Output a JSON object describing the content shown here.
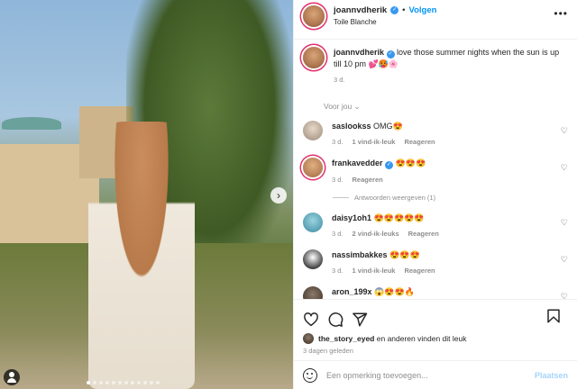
{
  "post": {
    "username": "joannvdherik",
    "follow_label": "Volgen",
    "separator": "•",
    "location": "Toile Blanche",
    "more_label": "•••",
    "caption_text": "love those summer nights when the sun is up till 10 pm 💕🥵🌸",
    "caption_age": "3 d.",
    "media_dots": 12,
    "media_active_dot": 0
  },
  "filter_label": "Voor jou ⌄",
  "comments": [
    {
      "user": "saslookss",
      "text": "OMG😍",
      "age": "3 d.",
      "likes": "1 vind-ik-leuk",
      "reply": "Reageren",
      "verified": false
    },
    {
      "user": "frankavedder",
      "text": "😍😍😍",
      "age": "3 d.",
      "likes": "",
      "reply": "Reageren",
      "verified": true
    },
    {
      "user": "daisy1oh1",
      "text": "😍😍😍😍😍",
      "age": "3 d.",
      "likes": "2 vind-ik-leuks",
      "reply": "Reageren",
      "verified": false
    },
    {
      "user": "nassimbakkes",
      "text": "😍😍😍",
      "age": "3 d.",
      "likes": "1 vind-ik-leuk",
      "reply": "Reageren",
      "verified": false
    },
    {
      "user": "aron_199x",
      "text": "😱😍😍🔥",
      "age": "",
      "likes": "",
      "reply": "",
      "verified": false
    }
  ],
  "view_replies": "Antwoorden weergeven (1)",
  "liked_by": {
    "user": "the_story_eyed",
    "rest": "en anderen vinden dit leuk"
  },
  "posted_ago": "3 dagen geleden",
  "composer": {
    "placeholder": "Een opmerking toevoegen...",
    "post_label": "Plaatsen"
  }
}
